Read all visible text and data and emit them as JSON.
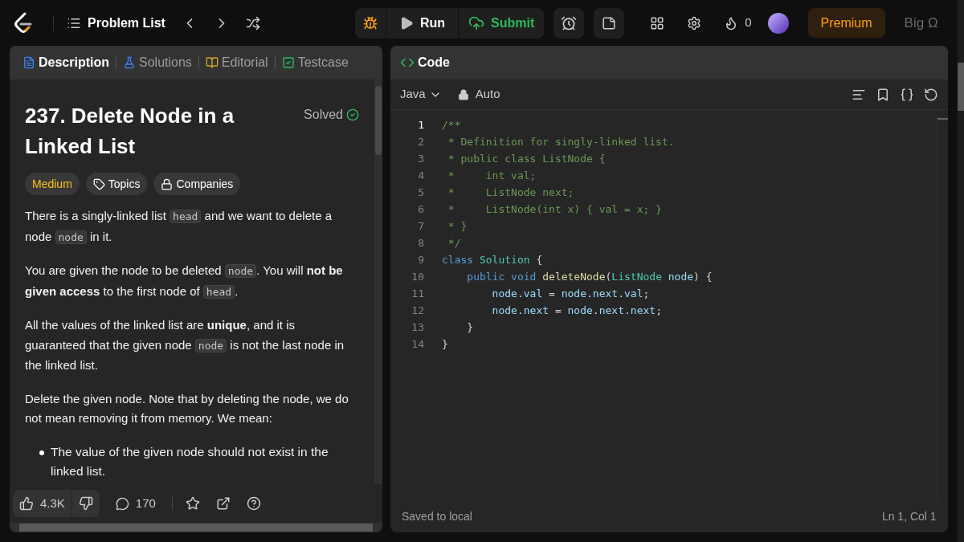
{
  "topbar": {
    "problem_list": "Problem List",
    "run": "Run",
    "submit": "Submit",
    "streak": "0",
    "premium": "Premium",
    "user": "Big Ω"
  },
  "left_tabs": [
    {
      "label": "Description",
      "kind": "description",
      "selected": true
    },
    {
      "label": "Solutions",
      "kind": "solutions",
      "selected": false
    },
    {
      "label": "Editorial",
      "kind": "editorial",
      "selected": false
    },
    {
      "label": "Testcase",
      "kind": "testcase",
      "selected": false
    }
  ],
  "problem": {
    "title": "237. Delete Node in a Linked List",
    "status": "Solved",
    "difficulty": "Medium",
    "tags": [
      {
        "label": "Topics",
        "kind": "topics"
      },
      {
        "label": "Companies",
        "kind": "companies"
      }
    ],
    "paragraphs": [
      [
        {
          "kind": "text",
          "text": "There is a singly-linked list "
        },
        {
          "kind": "code",
          "text": "head"
        },
        {
          "kind": "text",
          "text": " and we want to delete a node "
        },
        {
          "kind": "code",
          "text": "node"
        },
        {
          "kind": "text",
          "text": " in it."
        }
      ],
      [
        {
          "kind": "text",
          "text": "You are given the node to be deleted "
        },
        {
          "kind": "code",
          "text": "node"
        },
        {
          "kind": "text",
          "text": ". You will **not be given access** to the first node of "
        },
        {
          "kind": "code",
          "text": "head"
        },
        {
          "kind": "text",
          "text": "."
        }
      ],
      [
        {
          "kind": "text",
          "text": "All the values of the linked list are **unique**, and it is guaranteed that the given node "
        },
        {
          "kind": "code",
          "text": "node"
        },
        {
          "kind": "text",
          "text": " is not the last node in the linked list."
        }
      ],
      [
        {
          "kind": "text",
          "text": "Delete the given node. Note that by deleting the node, we do not mean removing it from memory. We mean:"
        }
      ]
    ],
    "bullets": [
      "The value of the given node should not exist in the linked list."
    ]
  },
  "footer": {
    "likes": "4.3K",
    "comments": "170"
  },
  "code_tab": {
    "label": "Code",
    "selected": true
  },
  "editor": {
    "language": "Java",
    "mode": "Auto",
    "status": "Saved to local",
    "cursor": "Ln 1, Col 1",
    "lines": [
      {
        "number": "1",
        "tokens": [
          {
            "kind": "comment",
            "text": "/**"
          }
        ]
      },
      {
        "number": "2",
        "tokens": [
          {
            "kind": "comment",
            "text": " * Definition for singly-linked list."
          }
        ]
      },
      {
        "number": "3",
        "tokens": [
          {
            "kind": "comment",
            "text": " * public class ListNode {"
          }
        ]
      },
      {
        "number": "4",
        "tokens": [
          {
            "kind": "comment",
            "text": " *     int val;"
          }
        ]
      },
      {
        "number": "5",
        "tokens": [
          {
            "kind": "comment",
            "text": " *     ListNode next;"
          }
        ]
      },
      {
        "number": "6",
        "tokens": [
          {
            "kind": "comment",
            "text": " *     ListNode(int x) { val = x; }"
          }
        ]
      },
      {
        "number": "7",
        "tokens": [
          {
            "kind": "comment",
            "text": " * }"
          }
        ]
      },
      {
        "number": "8",
        "tokens": [
          {
            "kind": "comment",
            "text": " */"
          }
        ]
      },
      {
        "number": "9",
        "tokens": [
          {
            "kind": "keyword",
            "text": "class "
          },
          {
            "kind": "type",
            "text": "Solution"
          },
          {
            "kind": "plain",
            "text": " {"
          }
        ]
      },
      {
        "number": "10",
        "tokens": [
          {
            "kind": "keyword",
            "text": "    public void "
          },
          {
            "kind": "func",
            "text": "deleteNode"
          },
          {
            "kind": "plain",
            "text": "("
          },
          {
            "kind": "type",
            "text": "ListNode"
          },
          {
            "kind": "var",
            "text": " node"
          },
          {
            "kind": "plain",
            "text": ") {"
          }
        ]
      },
      {
        "number": "11",
        "tokens": [
          {
            "kind": "var",
            "text": "        node"
          },
          {
            "kind": "plain",
            "text": "."
          },
          {
            "kind": "var",
            "text": "val"
          },
          {
            "kind": "plain",
            "text": " = "
          },
          {
            "kind": "var",
            "text": "node"
          },
          {
            "kind": "plain",
            "text": "."
          },
          {
            "kind": "var",
            "text": "next"
          },
          {
            "kind": "plain",
            "text": "."
          },
          {
            "kind": "var",
            "text": "val"
          },
          {
            "kind": "plain",
            "text": ";"
          }
        ]
      },
      {
        "number": "12",
        "tokens": [
          {
            "kind": "var",
            "text": "        node"
          },
          {
            "kind": "plain",
            "text": "."
          },
          {
            "kind": "var",
            "text": "next"
          },
          {
            "kind": "plain",
            "text": " = "
          },
          {
            "kind": "var",
            "text": "node"
          },
          {
            "kind": "plain",
            "text": "."
          },
          {
            "kind": "var",
            "text": "next"
          },
          {
            "kind": "plain",
            "text": "."
          },
          {
            "kind": "var",
            "text": "next"
          },
          {
            "kind": "plain",
            "text": ";"
          }
        ]
      },
      {
        "number": "13",
        "tokens": [
          {
            "kind": "plain",
            "text": "    }"
          }
        ]
      },
      {
        "number": "14",
        "tokens": [
          {
            "kind": "plain",
            "text": "}"
          }
        ]
      }
    ]
  }
}
